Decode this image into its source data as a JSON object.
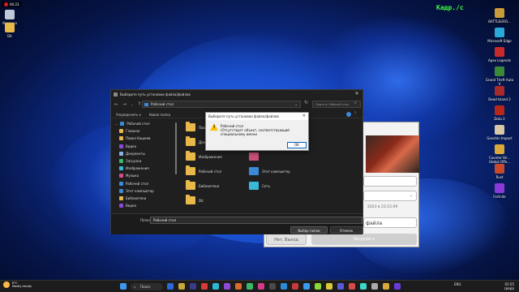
{
  "recording": {
    "time": "00:23"
  },
  "fps_overlay": "Кадр./с",
  "desktop_left": [
    {
      "label": "Корзина",
      "icon": "recycle-bin-icon",
      "color": "#bfc8d8"
    },
    {
      "label": "Dit",
      "icon": "folder-icon",
      "color": "#e8b84a"
    }
  ],
  "desktop_right": [
    {
      "label": "BATTLEGRO...",
      "icon": "pubg-icon",
      "color": "#c89a3a"
    },
    {
      "label": "Microsoft Edge",
      "icon": "edge-icon",
      "color": "#2aa8d8"
    },
    {
      "label": "Apex Legends",
      "icon": "apex-icon",
      "color": "#c82a2a"
    },
    {
      "label": "Grand Theft Auto V",
      "icon": "gta-icon",
      "color": "#3a8a3a"
    },
    {
      "label": "Dead Island 2",
      "icon": "dead-island-icon",
      "color": "#a82a2a"
    },
    {
      "label": "Dota 2",
      "icon": "dota-icon",
      "color": "#b8281a"
    },
    {
      "label": "Genshin Impact",
      "icon": "genshin-icon",
      "color": "#d8c8a8"
    },
    {
      "label": "Counter-Str... Global Offe...",
      "icon": "csgo-icon",
      "color": "#d8a83a"
    },
    {
      "label": "Rust",
      "icon": "rust-icon",
      "color": "#c84a2a"
    },
    {
      "label": "Fortnite",
      "icon": "fortnite-icon",
      "color": "#8a3ad8"
    }
  ],
  "bg_dialog": {
    "date_text": "2023 в 23:15:09",
    "file_btn": "файла",
    "cancel_btn": "Нет, Выход",
    "upload_btn": "Загрузить"
  },
  "file_dialog": {
    "title": "Выберите путь установки файла/файлов",
    "address": "Рабочий стол",
    "search_placeholder": "Поиск в: Рабочий стол",
    "organize": "Упорядочить ▾",
    "new_folder": "Новая папка",
    "sidebar": [
      {
        "label": "Рабочий стол",
        "color": "#3a8ad8",
        "top": true
      },
      {
        "label": "Главная",
        "color": "#e8b84a"
      },
      {
        "label": "Павел Кашеев",
        "color": "#e8b84a"
      },
      {
        "label": "Видео",
        "color": "#8a4ad8"
      },
      {
        "label": "Документы",
        "color": "#8ab0e8"
      },
      {
        "label": "Загрузки",
        "color": "#3ab86a"
      },
      {
        "label": "Изображения",
        "color": "#3ab8d8"
      },
      {
        "label": "Музыка",
        "color": "#d84a8a"
      },
      {
        "label": "Рабочий стол",
        "color": "#3a8ad8"
      },
      {
        "label": "Этот компьютер",
        "color": "#3a8ad8"
      },
      {
        "label": "Библиотеки",
        "color": "#e8b84a"
      },
      {
        "label": "Видео",
        "color": "#8a4ad8"
      }
    ],
    "items": [
      {
        "label": "Павел",
        "kind": "folder",
        "col": 0,
        "row": 0
      },
      {
        "label": "Документы",
        "kind": "folder",
        "col": 0,
        "row": 1
      },
      {
        "label": "Изображения",
        "kind": "folder",
        "col": 0,
        "row": 2
      },
      {
        "label": "Рабочий стол",
        "kind": "folder",
        "col": 0,
        "row": 3
      },
      {
        "label": "Библиотеки",
        "kind": "folder",
        "col": 0,
        "row": 4
      },
      {
        "label": "Dit",
        "kind": "folder",
        "col": 0,
        "row": 5
      },
      {
        "label": "",
        "kind": "app",
        "col": 1,
        "row": 2
      },
      {
        "label": "Этот компьютер",
        "kind": "computer",
        "col": 1,
        "row": 3
      },
      {
        "label": "Сеть",
        "kind": "network",
        "col": 1,
        "row": 4
      }
    ],
    "path_label": "Папка:",
    "path_value": "Рабочий стол",
    "select_btn": "Выбор папки",
    "cancel_btn": "Отмена"
  },
  "alert": {
    "title": "Выберите путь установки файла/файлов",
    "line1": "Рабочий стол",
    "line2": "(Отсутствует объект, соответствующий специальному имени",
    "ok": "OK"
  },
  "taskbar": {
    "temp": "6°C",
    "weather": "Mostly cloudy",
    "search": "Поиск",
    "lang": "ENG",
    "time": "01:55",
    "date": "среда"
  }
}
